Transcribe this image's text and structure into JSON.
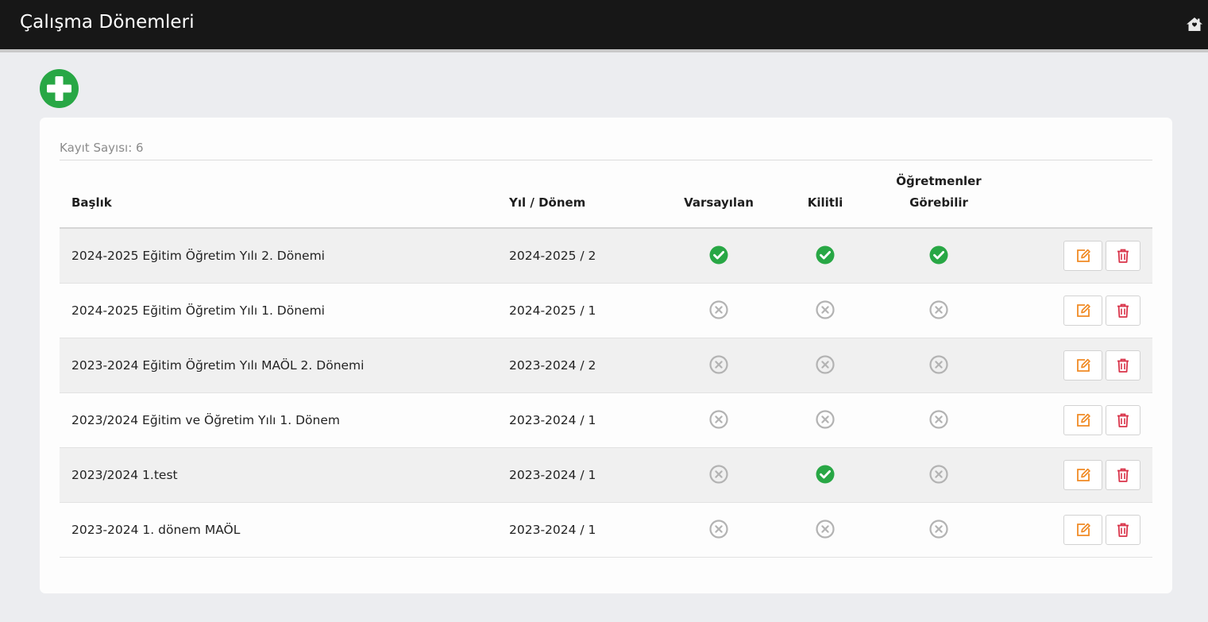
{
  "header": {
    "title": "Çalışma Dönemleri",
    "home_icon": "home-icon"
  },
  "toolbar": {
    "add_icon": "plus-circle-icon",
    "add_color": "#28a745"
  },
  "table": {
    "record_count_text": "Kayıt Sayısı: 6",
    "columns": {
      "title": "Başlık",
      "year_term": "Yıl / Dönem",
      "default": "Varsayılan",
      "locked": "Kilitli",
      "teachers_line1": "Öğretmenler",
      "teachers_line2": "Görebilir"
    },
    "rows": [
      {
        "title": "2024-2025 Eğitim Öğretim Yılı 2. Dönemi",
        "year_term": "2024-2025 / 2",
        "default": true,
        "locked": true,
        "teachers_visible": true
      },
      {
        "title": "2024-2025 Eğitim Öğretim Yılı 1. Dönemi",
        "year_term": "2024-2025 / 1",
        "default": false,
        "locked": false,
        "teachers_visible": false
      },
      {
        "title": "2023-2024 Eğitim Öğretim Yılı MAÖL 2. Dönemi",
        "year_term": "2023-2024 / 2",
        "default": false,
        "locked": false,
        "teachers_visible": false
      },
      {
        "title": "2023/2024 Eğitim ve Öğretim Yılı 1. Dönem",
        "year_term": "2023-2024 / 1",
        "default": false,
        "locked": false,
        "teachers_visible": false
      },
      {
        "title": "2023/2024 1.test",
        "year_term": "2023-2024 / 1",
        "default": false,
        "locked": true,
        "teachers_visible": false
      },
      {
        "title": "2023-2024 1. dönem MAÖL",
        "year_term": "2023-2024 / 1",
        "default": false,
        "locked": false,
        "teachers_visible": false
      }
    ],
    "actions": {
      "edit_icon": "edit-icon",
      "delete_icon": "trash-icon",
      "edit_color": "#f08a24",
      "delete_color": "#d9344a"
    }
  },
  "colors": {
    "check": "#28a745",
    "cross": "#b3b3b3"
  }
}
